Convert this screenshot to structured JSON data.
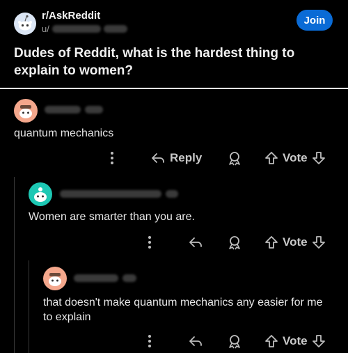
{
  "post": {
    "subreddit": "r/AskReddit",
    "user_prefix": "u/",
    "join_label": "Join",
    "title": "Dudes of Reddit, what is the hardest thing to explain to women?"
  },
  "comments": [
    {
      "text": "quantum mechanics",
      "actions": {
        "reply": "Reply",
        "vote": "Vote"
      },
      "avatar_color": "#f4a78c"
    },
    {
      "text": "Women are smarter than you are.",
      "actions": {
        "vote": "Vote"
      },
      "avatar_color": "#1dc8b4"
    },
    {
      "text": "that doesn't make quantum mechanics any easier for me to explain",
      "actions": {
        "vote": "Vote"
      },
      "avatar_color": "#f4a78c"
    }
  ],
  "colors": {
    "accent": "#0a6bd6",
    "background": "#000000"
  },
  "icons": [
    "reddit-snoo-icon",
    "more-vertical-icon",
    "reply-arrow-icon",
    "award-icon",
    "upvote-icon",
    "downvote-icon"
  ]
}
